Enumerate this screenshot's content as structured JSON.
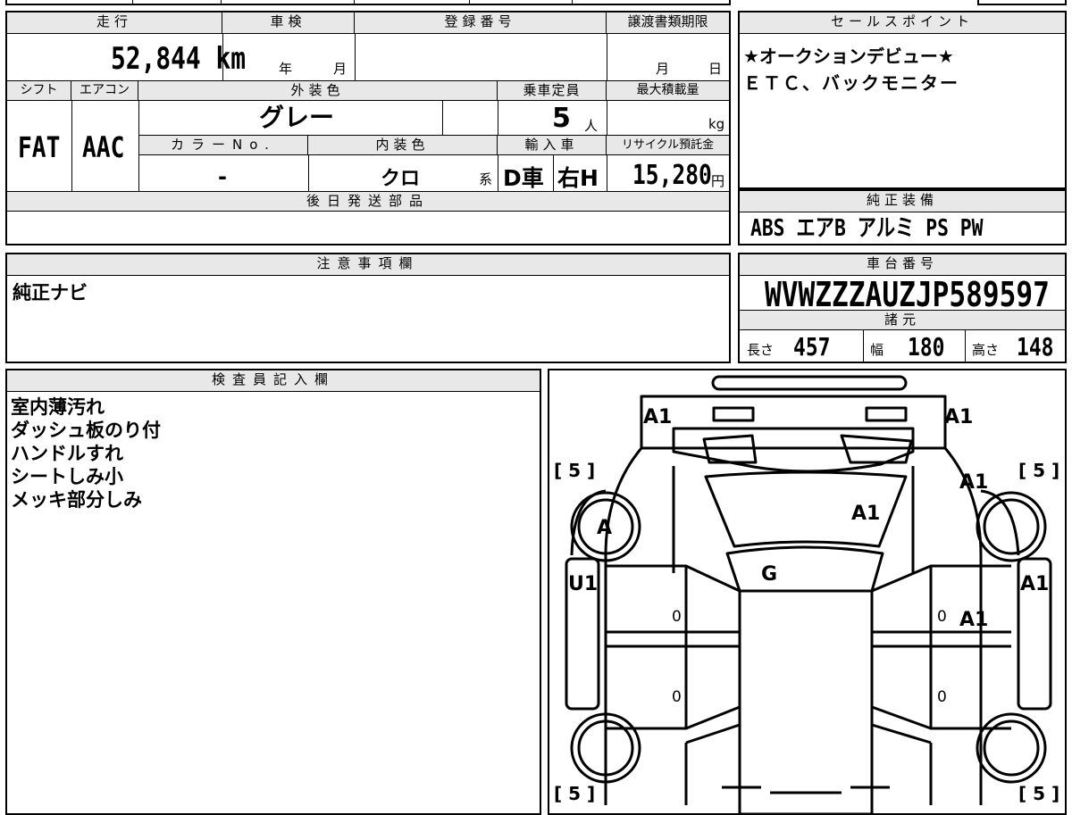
{
  "vehicle": {
    "mileage_label": "走行",
    "mileage_value": "52,844 km",
    "shaken_label": "車検",
    "shaken_year": "年",
    "shaken_month": "月",
    "reg_label": "登録番号",
    "transfer_label": "譲渡書類期限",
    "transfer_month": "月",
    "transfer_day": "日",
    "shift_label": "シフト",
    "shift_value": "FAT",
    "ac_label": "エアコン",
    "ac_value": "AAC",
    "ext_color_label": "外装色",
    "ext_color_value": "グレー",
    "capacity_label": "乗車定員",
    "capacity_value": "5",
    "capacity_unit": "人",
    "max_load_label": "最大積載量",
    "max_load_unit": "kg",
    "color_no_label": "カラーNo.",
    "color_no_value": "-",
    "int_color_label": "内装色",
    "int_color_value": "クロ",
    "int_color_suffix": "系",
    "import_label": "輸入車",
    "import_dealer": "D車",
    "import_handle": "右H",
    "recycle_label": "リサイクル預託金",
    "recycle_value": "15,280",
    "recycle_unit": "円",
    "later_parts_label": "後日発送部品"
  },
  "sales_points": {
    "label": "セールスポイント",
    "line1": "★オークションデビュー★",
    "line2": "ＥＴＣ、バックモニター"
  },
  "equipment": {
    "label": "純正装備",
    "value": "ABS エアB アルミ PS PW"
  },
  "caution": {
    "label": "注意事項欄",
    "value": "純正ナビ"
  },
  "chassis": {
    "label": "車台番号",
    "value": "WVWZZZAUZJP589597",
    "specs_label": "諸元",
    "length_label": "長さ",
    "length_value": "457",
    "width_label": "幅",
    "width_value": "180",
    "height_label": "高さ",
    "height_value": "148"
  },
  "inspector": {
    "label": "検査員記入欄",
    "notes": [
      "室内薄汚れ",
      "ダッシュ板のり付",
      "ハンドルすれ",
      "シートしみ小",
      "メッキ部分しみ"
    ]
  },
  "diagram": {
    "marks": {
      "front_left": "A1",
      "front_right": "A1",
      "hood": "A1",
      "right_fender": "A1",
      "left_wheel": "A",
      "windshield": "G",
      "left_front_door": "U1",
      "right_front_door_outer": "A1",
      "right_front_door": "A1"
    },
    "tires": [
      "[ 5 ]",
      "[ 5 ]",
      "[ 5 ]",
      "[ 5 ]"
    ],
    "zeros": [
      "0",
      "0",
      "0",
      "0"
    ]
  }
}
